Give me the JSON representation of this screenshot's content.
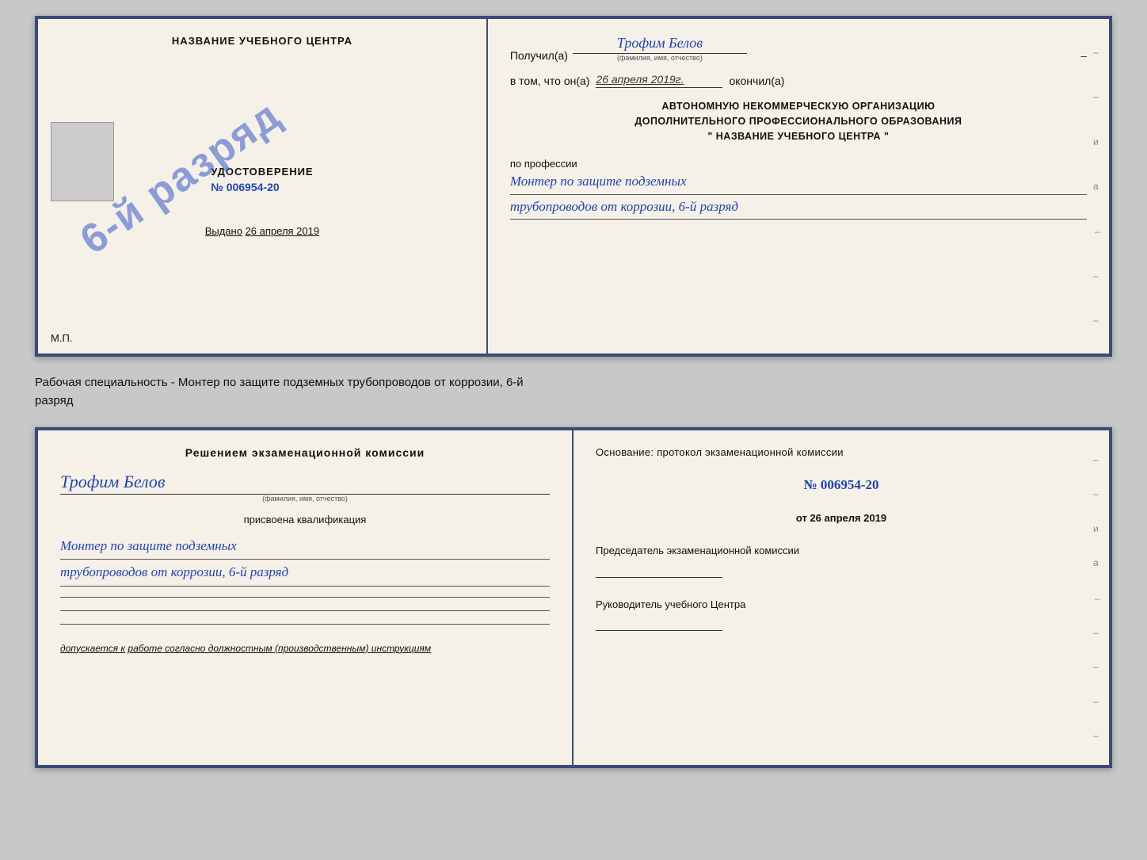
{
  "diploma": {
    "left": {
      "title": "НАЗВАНИЕ УЧЕБНОГО ЦЕНТРА",
      "stamp_text": "6-й разряд",
      "udostoverenie_title": "УДОСТОВЕРЕНИЕ",
      "udostoverenie_num_prefix": "№ ",
      "udostoverenie_num": "006954-20",
      "vydano_label": "Выдано",
      "vydano_date": "26 апреля 2019",
      "mp": "М.П."
    },
    "right": {
      "poluchil_label": "Получил(а)",
      "poluchil_name": "Трофим Белов",
      "fio_label": "(фамилия, имя, отчество)",
      "vtom_label": "в том, что он(а)",
      "vtom_date": "26 апреля 2019г.",
      "okonchil_label": "окончил(а)",
      "org_line1": "АВТОНОМНУЮ НЕКОММЕРЧЕСКУЮ ОРГАНИЗАЦИЮ",
      "org_line2": "ДОПОЛНИТЕЛЬНОГО ПРОФЕССИОНАЛЬНОГО ОБРАЗОВАНИЯ",
      "org_name": "\"   НАЗВАНИЕ УЧЕБНОГО ЦЕНТРА   \"",
      "po_professii": "по профессии",
      "profession_line1": "Монтер по защите подземных",
      "profession_line2": "трубопроводов от коррозии, 6-й разряд"
    }
  },
  "between": {
    "text_line1": "Рабочая специальность - Монтер по защите подземных трубопроводов от коррозии, 6-й",
    "text_line2": "разряд"
  },
  "bottom": {
    "left": {
      "reshenie_title": "Решением экзаменационной комиссии",
      "fio_name": "Трофим Белов",
      "fio_label": "(фамилия, имя, отчество)",
      "prisvoena": "присвоена квалификация",
      "qual_line1": "Монтер по защите подземных",
      "qual_line2": "трубопроводов от коррозии, 6-й разряд",
      "dopuskaetsya_label": "допускается к",
      "dopuskaetsya_text": "работе согласно должностным (производственным) инструкциям"
    },
    "right": {
      "osnovaniye_label": "Основание: протокол экзаменационной комиссии",
      "protocol_num": "№  006954-20",
      "ot_label": "от",
      "ot_date": "26 апреля 2019",
      "predsedatel_title": "Председатель экзаменационной комиссии",
      "rukovoditel_title": "Руководитель учебного Центра"
    }
  },
  "right_marks": [
    "–",
    "–",
    "и",
    "а",
    "←",
    "–",
    "–",
    "–",
    "–"
  ]
}
